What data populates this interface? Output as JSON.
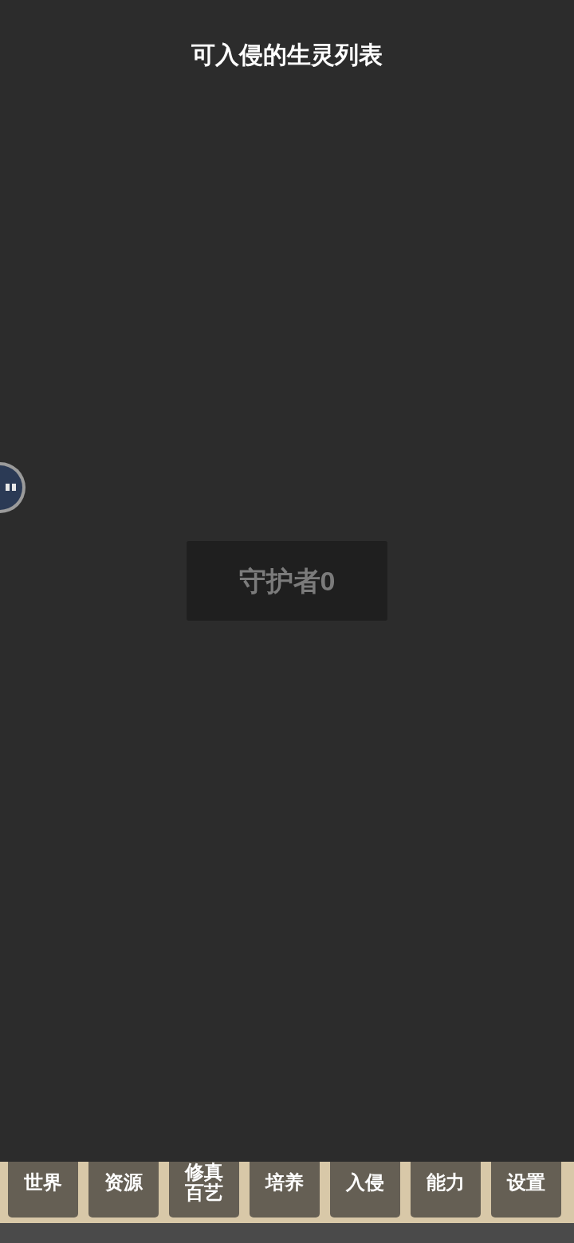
{
  "title": "可入侵的生灵列表",
  "guardians": [
    {
      "label": "守护者0"
    }
  ],
  "tabs": [
    {
      "label": "世界"
    },
    {
      "label": "资源"
    },
    {
      "label": "修真百艺"
    },
    {
      "label": "培养"
    },
    {
      "label": "入侵"
    },
    {
      "label": "能力"
    },
    {
      "label": "设置"
    }
  ]
}
